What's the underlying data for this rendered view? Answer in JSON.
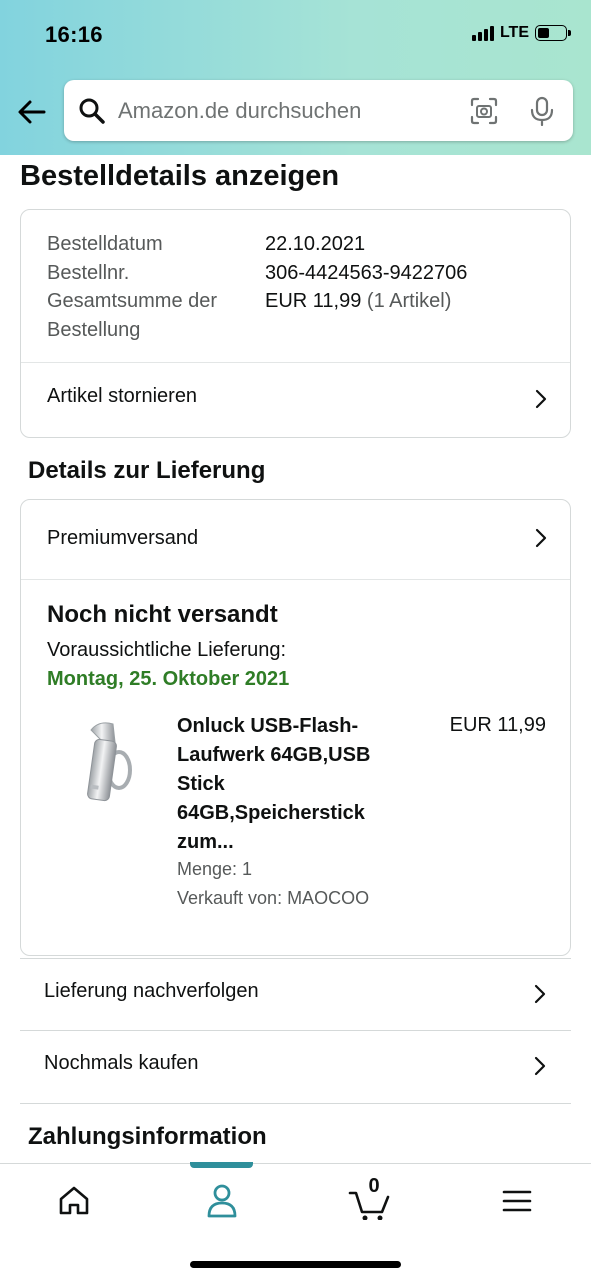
{
  "status_bar": {
    "time": "16:16",
    "network": "LTE"
  },
  "search": {
    "placeholder": "Amazon.de durchsuchen"
  },
  "page_title": "Bestelldetails anzeigen",
  "order_summary": {
    "date_label": "Bestelldatum",
    "date_value": "22.10.2021",
    "number_label": "Bestellnr.",
    "number_value": "306-4424563-9422706",
    "total_label_1": "Gesamtsumme der",
    "total_label_2": "Bestellung",
    "total_value": "EUR 11,99",
    "total_items": "(1 Artikel)",
    "cancel_label": "Artikel stornieren"
  },
  "delivery": {
    "section_title": "Details zur Lieferung",
    "shipping_method": "Premiumversand",
    "status": "Noch nicht versandt",
    "eta_label": "Voraussichtliche Lieferung:",
    "eta_date": "Montag, 25. Oktober 2021",
    "product": {
      "title": "Onluck USB-Flash-Laufwerk 64GB,USB Stick 64GB,Speicherstick zum...",
      "price": "EUR 11,99",
      "quantity": "Menge: 1",
      "seller": "Verkauft von: MAOCOO"
    }
  },
  "actions": {
    "track": "Lieferung nachverfolgen",
    "buy_again": "Nochmals kaufen"
  },
  "payment": {
    "section_title": "Zahlungsinformation"
  },
  "tabbar": {
    "cart_count": "0",
    "active_tab": "account"
  },
  "colors": {
    "header_gradient_start": "#82d3de",
    "header_gradient_end": "#a9e5cf",
    "eta_green": "#2f7d26",
    "tab_accent": "#2f8f9b"
  }
}
